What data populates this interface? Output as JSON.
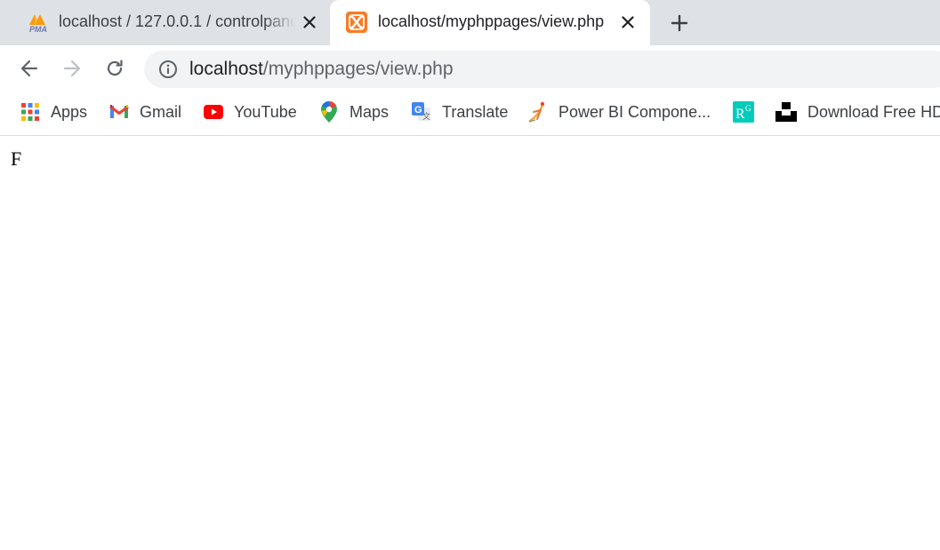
{
  "tabs": [
    {
      "title": "localhost / 127.0.0.1 / controlpanel",
      "favicon": "phpmyadmin-icon",
      "active": false
    },
    {
      "title": "localhost/myphppages/view.php",
      "favicon": "xampp-icon",
      "active": true
    }
  ],
  "toolbar": {
    "url_host": "localhost",
    "url_path": "/myphppages/view.php"
  },
  "bookmarks": [
    {
      "label": "Apps",
      "icon": "apps-grid-icon"
    },
    {
      "label": "Gmail",
      "icon": "gmail-icon"
    },
    {
      "label": "YouTube",
      "icon": "youtube-icon"
    },
    {
      "label": "Maps",
      "icon": "maps-pin-icon"
    },
    {
      "label": "Translate",
      "icon": "translate-icon"
    },
    {
      "label": "Power BI Compone...",
      "icon": "powerbi-icon"
    },
    {
      "label": "",
      "icon": "rg-icon"
    },
    {
      "label": "Download Free HD",
      "icon": "unsplash-icon"
    }
  ],
  "page": {
    "text": "F"
  },
  "colors": {
    "tabstrip": "#dee1e6",
    "omnibox": "#f1f3f4",
    "xampp": "#fb7a24",
    "youtube": "#ff0000"
  }
}
